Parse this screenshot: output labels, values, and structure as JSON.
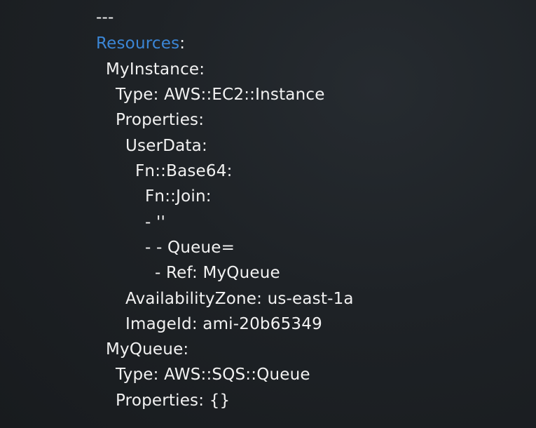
{
  "code": {
    "language": "yaml",
    "accent_color": "#3b86d6",
    "text_color": "#f2f2f2",
    "background_color": "#1e2226",
    "lines": [
      {
        "text": "---"
      },
      {
        "key": "Resources",
        "suffix": ":"
      },
      {
        "text": "MyInstance:"
      },
      {
        "text": "Type: AWS::EC2::Instance"
      },
      {
        "text": "Properties:"
      },
      {
        "text": "UserData:"
      },
      {
        "text": "Fn::Base64:"
      },
      {
        "text": "Fn::Join:"
      },
      {
        "text": "- ''"
      },
      {
        "text": "- - Queue="
      },
      {
        "text": "- Ref: MyQueue"
      },
      {
        "text": "AvailabilityZone: us-east-1a"
      },
      {
        "text": "ImageId: ami-20b65349"
      },
      {
        "text": "MyQueue:"
      },
      {
        "text": "Type: AWS::SQS::Queue"
      },
      {
        "text": "Properties: {}"
      }
    ]
  }
}
